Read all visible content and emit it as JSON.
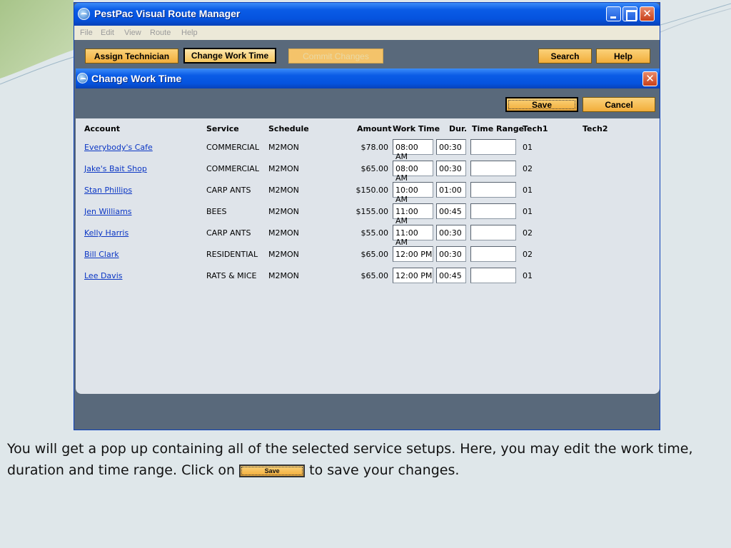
{
  "window": {
    "title": "PestPac Visual Route Manager",
    "menu": [
      "File",
      "Edit",
      "View",
      "Route",
      "Help"
    ],
    "toolbar": {
      "assign_technician": "Assign Technician",
      "change_work_time": "Change Work Time",
      "commit_changes": "Commit Changes",
      "search": "Search",
      "help": "Help"
    }
  },
  "dialog": {
    "title": "Change Work Time",
    "save_label": "Save",
    "cancel_label": "Cancel",
    "columns": {
      "account": "Account",
      "service": "Service",
      "schedule": "Schedule",
      "amount": "Amount",
      "work_time": "Work Time",
      "duration": "Dur.",
      "time_range": "Time Range",
      "tech1": "Tech1",
      "tech2": "Tech2"
    },
    "rows": [
      {
        "account": "Everybody's Cafe",
        "service": "COMMERCIAL",
        "schedule": "M2MON",
        "amount": "$78.00",
        "work_time": "08:00 AM",
        "duration": "00:30",
        "time_range": "",
        "tech1": "01",
        "tech2": ""
      },
      {
        "account": "Jake's Bait Shop",
        "service": "COMMERCIAL",
        "schedule": "M2MON",
        "amount": "$65.00",
        "work_time": "08:00 AM",
        "duration": "00:30",
        "time_range": "",
        "tech1": "02",
        "tech2": ""
      },
      {
        "account": "Stan Phillips",
        "service": "CARP ANTS",
        "schedule": "M2MON",
        "amount": "$150.00",
        "work_time": "10:00 AM",
        "duration": "01:00",
        "time_range": "",
        "tech1": "01",
        "tech2": ""
      },
      {
        "account": "Jen Williams",
        "service": "BEES",
        "schedule": "M2MON",
        "amount": "$155.00",
        "work_time": "11:00 AM",
        "duration": "00:45",
        "time_range": "",
        "tech1": "01",
        "tech2": ""
      },
      {
        "account": "Kelly Harris",
        "service": "CARP ANTS",
        "schedule": "M2MON",
        "amount": "$55.00",
        "work_time": "11:00 AM",
        "duration": "00:30",
        "time_range": "",
        "tech1": "02",
        "tech2": ""
      },
      {
        "account": "Bill Clark",
        "service": "RESIDENTIAL",
        "schedule": "M2MON",
        "amount": "$65.00",
        "work_time": "12:00 PM",
        "duration": "00:30",
        "time_range": "",
        "tech1": "02",
        "tech2": ""
      },
      {
        "account": "Lee Davis",
        "service": "RATS & MICE",
        "schedule": "M2MON",
        "amount": "$65.00",
        "work_time": "12:00 PM",
        "duration": "00:45",
        "time_range": "",
        "tech1": "01",
        "tech2": ""
      }
    ]
  },
  "caption": {
    "before": "You will get a pop up containing all of the selected service setups.  Here, you may edit the work time, duration and time range.  Click on ",
    "button": "Save",
    "after": " to save your changes."
  },
  "colors": {
    "titlebar_blue": "#0553de",
    "button_orange": "#f2ad3a",
    "window_gray": "#59697b",
    "link_blue": "#0b36c4"
  }
}
